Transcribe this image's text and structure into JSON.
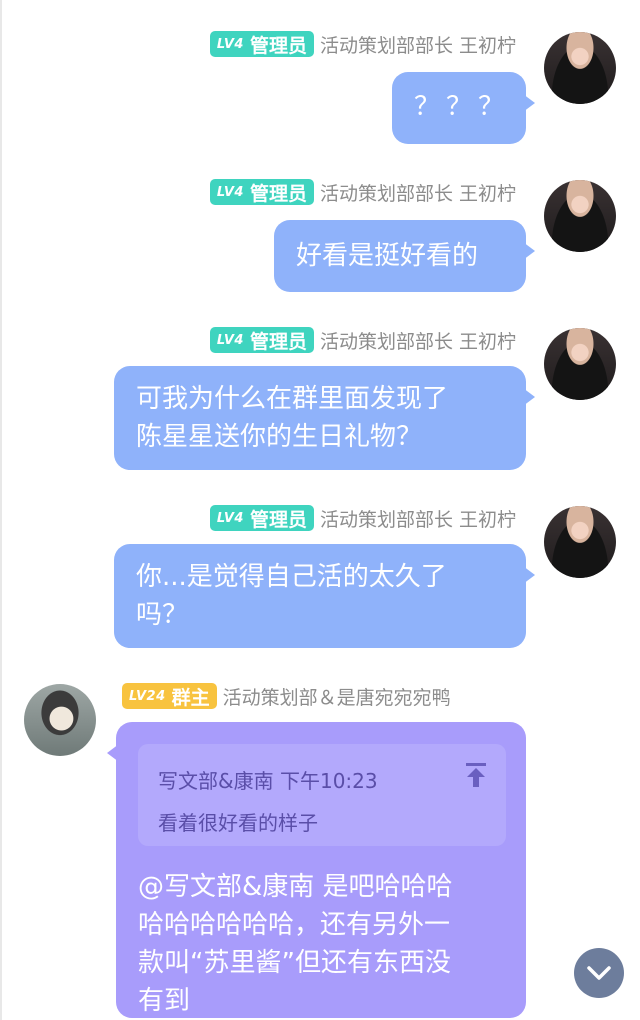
{
  "colors": {
    "self_bubble": "#8fb2fa",
    "owner_bubble": "#a89cfb",
    "admin_badge": "#3fd4bf",
    "owner_badge": "#f8c33f",
    "name_text": "#8c8c8c"
  },
  "messages": [
    {
      "level": "LV4",
      "role": "管理员",
      "sender": "活动策划部部长 王初柠",
      "lines": [
        "？？？"
      ]
    },
    {
      "level": "LV4",
      "role": "管理员",
      "sender": "活动策划部部长 王初柠",
      "lines": [
        "好看是挺好看的"
      ]
    },
    {
      "level": "LV4",
      "role": "管理员",
      "sender": "活动策划部部长 王初柠",
      "lines": [
        "可我为什么在群里面发现了",
        "陈星星送你的生日礼物？"
      ]
    },
    {
      "level": "LV4",
      "role": "管理员",
      "sender": "活动策划部部长 王初柠",
      "lines": [
        "你...是觉得自己活的太久了",
        "吗？"
      ]
    },
    {
      "level": "LV24",
      "role": "群主",
      "sender": "活动策划部＆是唐宛宛宛鸭",
      "quote": {
        "author": "写文部&康南",
        "time": "下午10:23",
        "text": "看着很好看的样子"
      },
      "lines": [
        "@写文部&康南 是吧哈哈哈",
        "哈哈哈哈哈哈，还有另外一",
        "款叫“苏里酱”但还有东西没",
        "有到"
      ]
    }
  ],
  "icons": {
    "quote_pin": "arrow-up-to-line-icon",
    "scroll": "chevron-down-icon"
  }
}
